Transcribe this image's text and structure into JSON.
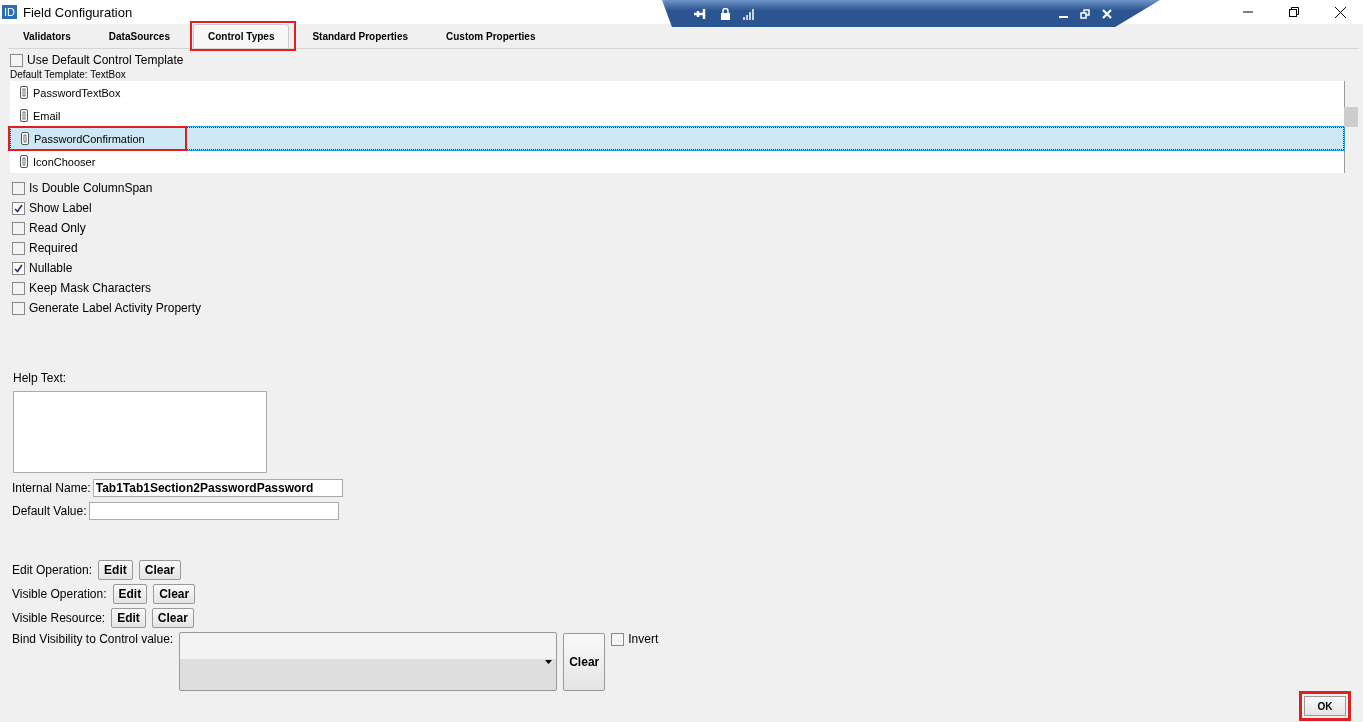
{
  "window": {
    "title": "Field Configuration",
    "app_badge": "ID"
  },
  "tabs": [
    {
      "label": "Validators",
      "selected": false,
      "highlighted": false
    },
    {
      "label": "DataSources",
      "selected": false,
      "highlighted": false
    },
    {
      "label": "Control Types",
      "selected": true,
      "highlighted": true
    },
    {
      "label": "Standard Properties",
      "selected": false,
      "highlighted": false
    },
    {
      "label": "Custom Properties",
      "selected": false,
      "highlighted": false
    }
  ],
  "use_default_template": {
    "label": "Use Default Control Template",
    "checked": false
  },
  "default_template": "Default Template: TextBox",
  "control_types": [
    {
      "label": "PasswordTextBox",
      "selected": false,
      "highlighted": false
    },
    {
      "label": "Email",
      "selected": false,
      "highlighted": false
    },
    {
      "label": "PasswordConfirmation",
      "selected": true,
      "highlighted": true
    },
    {
      "label": "IconChooser",
      "selected": false,
      "highlighted": false
    }
  ],
  "options": [
    {
      "label": "Is Double ColumnSpan",
      "checked": false
    },
    {
      "label": "Show Label",
      "checked": true
    },
    {
      "label": "Read Only",
      "checked": false
    },
    {
      "label": "Required",
      "checked": false
    },
    {
      "label": "Nullable",
      "checked": true
    },
    {
      "label": "Keep Mask Characters",
      "checked": false
    },
    {
      "label": "Generate Label Activity Property",
      "checked": false
    }
  ],
  "help_text": {
    "label": "Help Text:"
  },
  "fields": [
    {
      "label": "Internal Name:",
      "value": "Tab1Tab1Section2PasswordPassword"
    },
    {
      "label": "Default Value:"
    }
  ],
  "operations": [
    {
      "label": "Edit Operation:",
      "buttons": [
        "Edit",
        "Clear"
      ]
    },
    {
      "label": "Visible Operation:",
      "buttons": [
        "Edit",
        "Clear"
      ]
    },
    {
      "label": "Visible Resource:",
      "buttons": [
        "Edit",
        "Clear"
      ]
    }
  ],
  "bind_visibility": {
    "label": "Bind Visibility to Control value:",
    "clear": "Clear",
    "invert": {
      "label": "Invert",
      "checked": false
    }
  },
  "ok_button": {
    "label": "OK",
    "highlighted": true
  }
}
